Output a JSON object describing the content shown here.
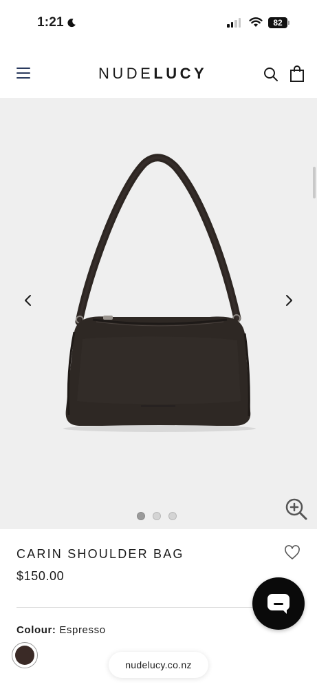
{
  "status_bar": {
    "time": "1:21",
    "battery": "82"
  },
  "header": {
    "logo_regular": "NUDE",
    "logo_bold": "LUCY",
    "icons": [
      "menu-icon",
      "search-icon",
      "shopping-bag-icon"
    ]
  },
  "gallery": {
    "slide_count": 3,
    "active_slide": 1,
    "image_description": "product-photo",
    "icons": [
      "chevron-left-icon",
      "chevron-right-icon",
      "zoom-in-icon"
    ]
  },
  "product": {
    "title": "CARIN SHOULDER BAG",
    "price": "$150.00",
    "colour_label": "Colour:",
    "colour_value": "Espresso",
    "swatch_color": "#3a2a26"
  },
  "chat": {
    "icon": "chat-icon",
    "color": "#0a0a0a"
  },
  "browser": {
    "url": "nudelucy.co.nz"
  }
}
